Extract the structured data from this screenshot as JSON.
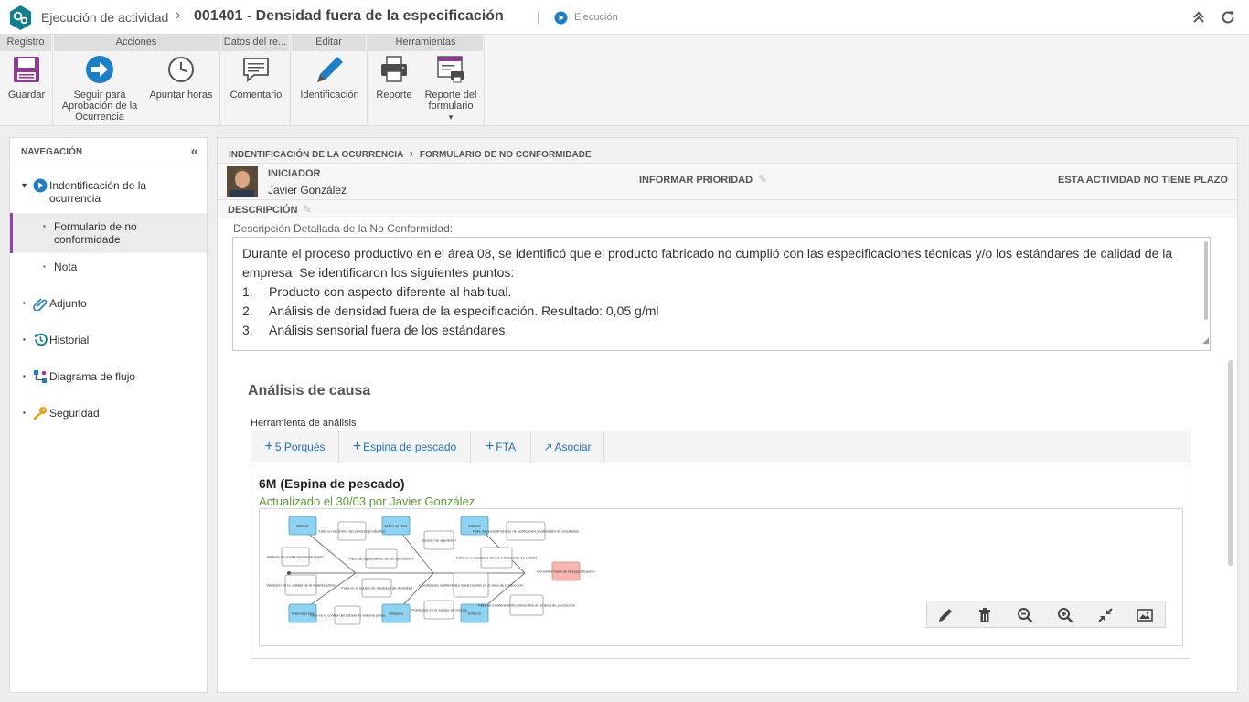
{
  "header": {
    "app_title": "Ejecución de actividad",
    "separator": "›",
    "doc_title": "001401 - Densidad fuera de la especificación",
    "status": "Ejecución",
    "icons": [
      "gear-logo-icon",
      "collapse-up-icon",
      "refresh-icon"
    ]
  },
  "ribbon": {
    "groups": [
      {
        "title": "Registro",
        "buttons": [
          {
            "label": "Guardar",
            "icon": "save-icon"
          }
        ]
      },
      {
        "title": "Acciones",
        "buttons": [
          {
            "label": "Seguir para Aprobación de la Ocurrencia",
            "icon": "arrow-right-icon"
          },
          {
            "label": "Apuntar horas",
            "icon": "clock-icon"
          }
        ]
      },
      {
        "title": "Datos del re...",
        "buttons": [
          {
            "label": "Comentario",
            "icon": "comment-icon"
          }
        ]
      },
      {
        "title": "Editar",
        "buttons": [
          {
            "label": "Identificación",
            "icon": "pencil-icon"
          }
        ]
      },
      {
        "title": "Herramientas",
        "buttons": [
          {
            "label": "Reporte",
            "icon": "printer-icon"
          },
          {
            "label": "Reporte del formulario",
            "icon": "form-report-icon"
          }
        ]
      }
    ],
    "dropdown_arrow": "▾"
  },
  "nav": {
    "title": "NAVEGACIÓN",
    "collapse": "«",
    "items": [
      {
        "label": "Indentificación de la ocurrencia",
        "icon": "play-circle-icon",
        "expanded": true
      },
      {
        "label": "Formulario de no conformidade",
        "selected": true
      },
      {
        "label": "Nota"
      },
      {
        "label": "Adjunto",
        "icon": "paperclip-icon"
      },
      {
        "label": "Historial",
        "icon": "history-icon"
      },
      {
        "label": "Diagrama de flujo",
        "icon": "flow-icon"
      },
      {
        "label": "Seguridad",
        "icon": "key-icon"
      }
    ],
    "bullet": "▪",
    "caret": "▾"
  },
  "content": {
    "breadcrumb_1": "INDENTIFICACIÓN DE LA OCURRENCIA",
    "breadcrumb_sep": "›",
    "breadcrumb_2": "FORMULARIO DE NO CONFORMIDADE",
    "initiator_label": "INICIADOR",
    "initiator_name": "Javier González",
    "priority_label": "INFORMAR PRIORIDAD",
    "deadline": "ESTA ACTIVIDAD NO TIENE PLAZO",
    "description_label": "DESCRIPCIÓN",
    "field_label": "Descripción Detallada de la No Conformidad:",
    "description_lines": [
      "Durante el proceso productivo en el área 08, se identificó que el producto fabricado no cumplió con las especificaciones técnicas y/o los estándares de calidad de la",
      "empresa. Se identificaron los siguientes puntos:"
    ],
    "description_list": [
      {
        "num": "1.",
        "text": "Producto con aspecto diferente al habitual."
      },
      {
        "num": "2.",
        "text": "Análisis de densidad fuera de la especificación. Resultado: 0,05 g/ml"
      },
      {
        "num": "3.",
        "text": "Análisis sensorial fuera de los estándares."
      }
    ]
  },
  "analysis": {
    "section_title": "Análisis de causa",
    "tool_label": "Herramienta de análisis",
    "tabs": [
      {
        "plus": "+",
        "label": "5 Porqués"
      },
      {
        "plus": "+",
        "label": "Espina de pescado"
      },
      {
        "plus": "+",
        "label": "FTA"
      },
      {
        "plus": "↗",
        "label": "Asociar"
      }
    ],
    "card_title": "6M (Espina de pescado)",
    "card_subtitle": "Actualizado el 30/03 por Javier González",
    "diagram_tools": [
      "pencil-icon",
      "trash-icon",
      "zoom-out-icon",
      "zoom-in-icon",
      "compress-icon",
      "image-icon"
    ]
  },
  "fishbone": {
    "effect": "Densidad fuera de la especificación",
    "categories": [
      "Método",
      "Mano de obra",
      "Medida",
      "Materia prima",
      "Máquina",
      "Entorno"
    ],
    "causes": [
      "Falla en el control del proceso productivo",
      "Método de producción inadecuado",
      "Falta de capacitación de los operadores",
      "Exceso de operación",
      "Falla de procedimientos de verificación y validación de resultados",
      "Falla en el resultado de los indicadores de calidad",
      "Variación en la calidad de la materia prima",
      "Falla en el equipo de medición de densidad",
      "Condiciones ambientales inadecuadas en el área de producción",
      "Falla en el control del estado de materia prima",
      "Problemas en el equipo de mezcla",
      "Falla de mantenimiento preventivo en el área de producción"
    ]
  },
  "colors": {
    "accent": "#1f7fc4",
    "teal_logo": "#137d8c",
    "purple_selected": "#8e44ad",
    "category_fill": "#8fd3f0",
    "effect_fill": "#f5b5b0",
    "subtitle_green": "#5c9a3c",
    "link_blue": "#2a6fb5"
  }
}
